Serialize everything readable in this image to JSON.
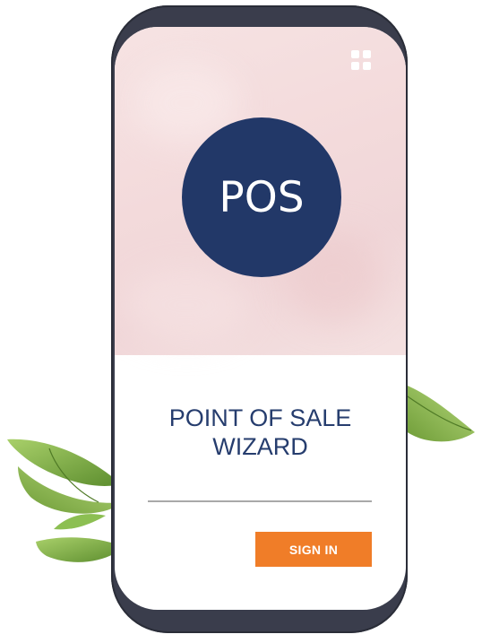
{
  "app": {
    "logo_text": "POS",
    "title_lines": [
      "POINT OF SALE",
      "WIZARD"
    ],
    "sign_in_label": "SIGN IN",
    "menu_icon": "grid-icon"
  },
  "colors": {
    "phone_frame": "#3a3d4c",
    "logo_circle": "#223868",
    "title_text": "#263d6e",
    "sign_in_button": "#f07d28",
    "hero_background": "#f3dadb",
    "leaf_green": "#7fb24a"
  }
}
